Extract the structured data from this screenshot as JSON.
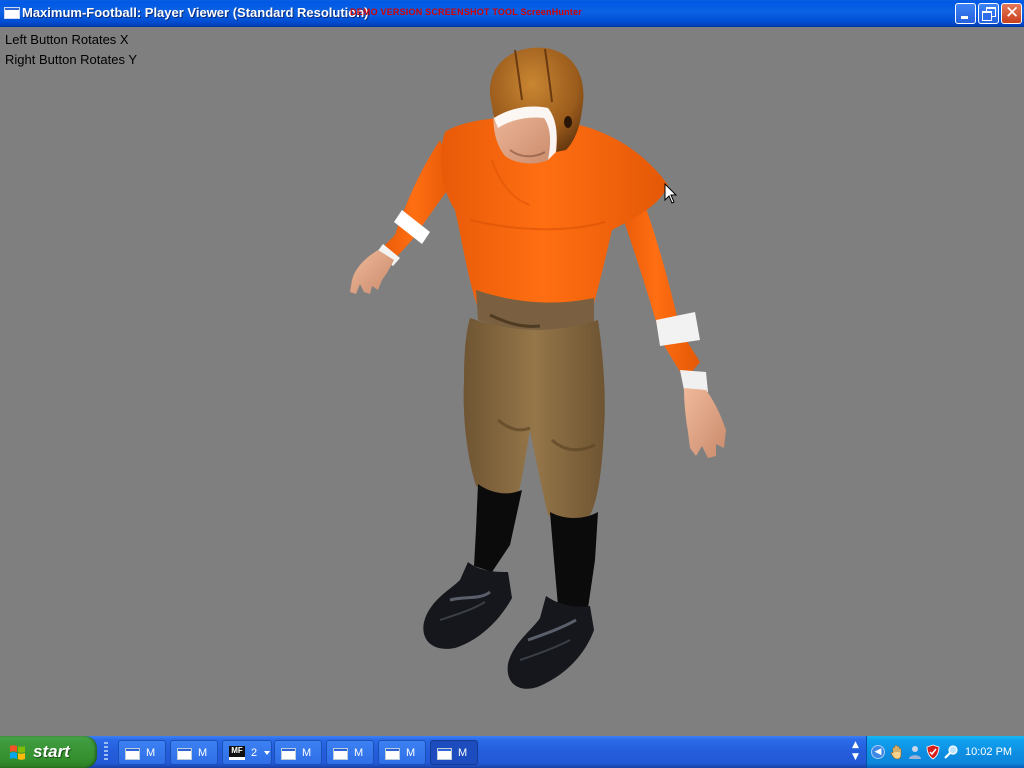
{
  "window": {
    "title": "Maximum-Football: Player Viewer (Standard Resolution)",
    "overlay_text": "DEMO VERSION  SCREENSHOT TOOL  ScreenHunter"
  },
  "instructions": {
    "left_button": "Left Button Rotates X",
    "right_button": "Right Button Rotates Y"
  },
  "colors": {
    "background": "#7f7f7f",
    "jersey": "#ff6a0c",
    "pants": "#8a6d42",
    "helmet": "#a0621d"
  },
  "taskbar": {
    "start_label": "start",
    "tasks": [
      {
        "label": "M",
        "active": false
      },
      {
        "label": "M",
        "active": false
      },
      {
        "label": "2",
        "group_icon": "MF",
        "active": false
      },
      {
        "label": "M",
        "active": false
      },
      {
        "label": "M",
        "active": false
      },
      {
        "label": "M",
        "active": false
      },
      {
        "label": "M",
        "active": true
      }
    ],
    "tray_icons": [
      "chevron-left-icon",
      "hand-icon",
      "user-icon",
      "security-shield-icon",
      "magnifier-icon"
    ],
    "clock": "10:02 PM"
  }
}
